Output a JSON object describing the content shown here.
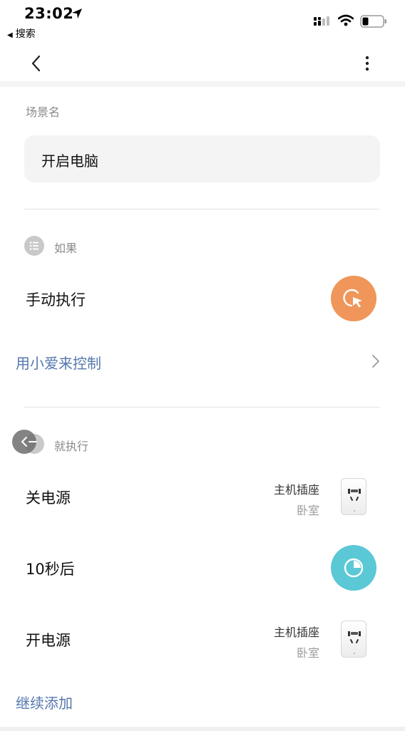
{
  "status_bar": {
    "time": "23:02",
    "back_app_label": "搜索"
  },
  "nav": {
    "back_icon": "chevron-left-icon",
    "more_icon": "more-vertical-icon"
  },
  "scene": {
    "name_label": "场景名",
    "name_value": "开启电脑"
  },
  "if_section": {
    "label": "如果",
    "condition": "手动执行",
    "voice_control": "用小爱来控制"
  },
  "then_section": {
    "label": "就执行",
    "actions": [
      {
        "title": "关电源",
        "device": "主机插座",
        "room": "卧室"
      },
      {
        "title": "10秒后"
      },
      {
        "title": "开电源",
        "device": "主机插座",
        "room": "卧室"
      }
    ],
    "add_more": "继续添加"
  },
  "colors": {
    "accent_blue": "#5577ad",
    "manual_orange": "#f0965a",
    "delay_teal": "#5bc8d6"
  }
}
